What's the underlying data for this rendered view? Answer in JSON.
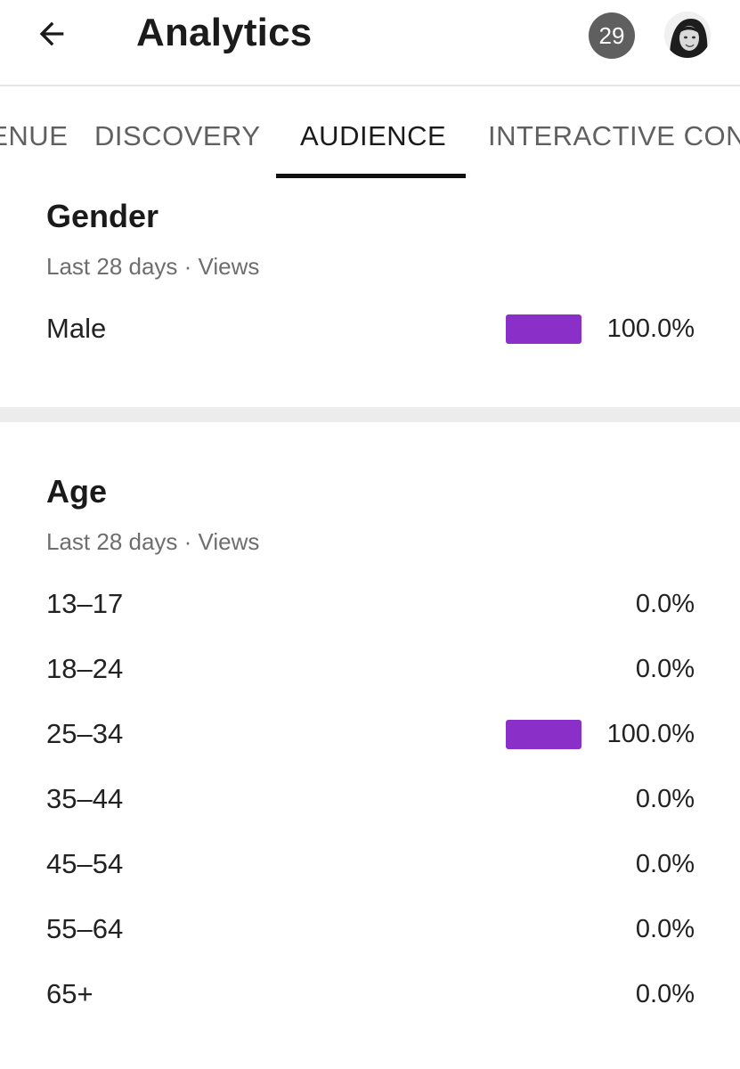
{
  "header": {
    "title": "Analytics",
    "notification_count": "29"
  },
  "tabs": [
    {
      "label": "REVENUE",
      "active": false
    },
    {
      "label": "DISCOVERY",
      "active": false
    },
    {
      "label": "AUDIENCE",
      "active": true
    },
    {
      "label": "INTERACTIVE CONTENT",
      "active": false
    }
  ],
  "gender": {
    "title": "Gender",
    "subtitle": "Last 28 days · Views",
    "rows": [
      {
        "label": "Male",
        "value": "100.0%",
        "share": 1.0
      }
    ]
  },
  "age": {
    "title": "Age",
    "subtitle": "Last 28 days · Views",
    "rows": [
      {
        "label": "13–17",
        "value": "0.0%",
        "share": 0.0
      },
      {
        "label": "18–24",
        "value": "0.0%",
        "share": 0.0
      },
      {
        "label": "25–34",
        "value": "100.0%",
        "share": 1.0
      },
      {
        "label": "35–44",
        "value": "0.0%",
        "share": 0.0
      },
      {
        "label": "45–54",
        "value": "0.0%",
        "share": 0.0
      },
      {
        "label": "55–64",
        "value": "0.0%",
        "share": 0.0
      },
      {
        "label": "65+",
        "value": "0.0%",
        "share": 0.0
      }
    ]
  },
  "colors": {
    "bar": "#8b2fc9",
    "badge": "#5f5f5f",
    "divider": "#ececec"
  },
  "icons": {
    "back": "arrow-left-icon",
    "avatar": "avatar"
  }
}
